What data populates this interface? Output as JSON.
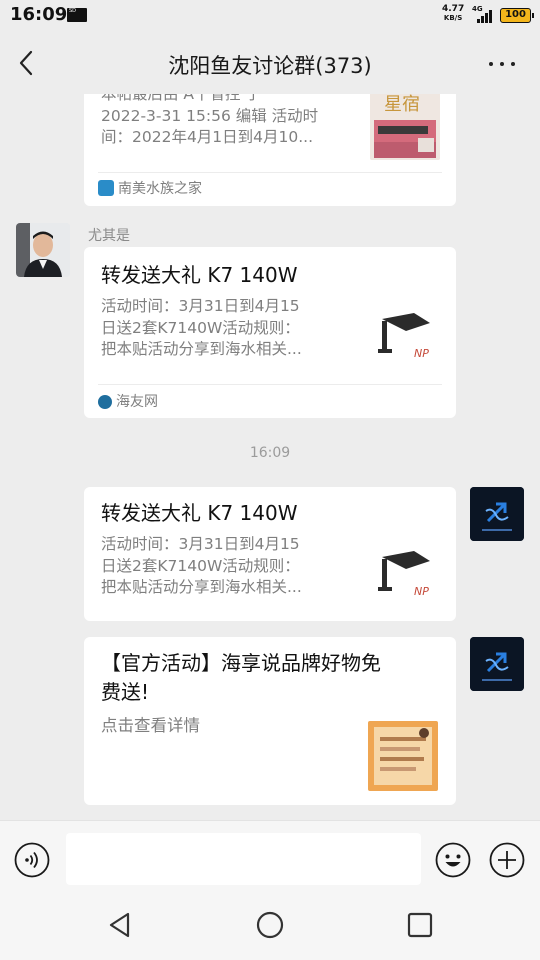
{
  "status_bar": {
    "time": "16:09",
    "sd_label": "SD",
    "speed_value": "4.77",
    "speed_unit": "KB/S",
    "network": "4G",
    "battery": "100"
  },
  "header": {
    "title": "沈阳鱼友讨论群(373)",
    "back_icon": "chevron-left-icon",
    "more_icon": "more-dots-icon"
  },
  "messages": [
    {
      "type": "link-card-partial",
      "desc_lines": [
        "本帖最后由 A十省控 于",
        "2022-3-31 15:56 编辑 活动时",
        "间：2022年4月1日到4月10..."
      ],
      "thumb_label": "星宿",
      "source": "南美水族之家"
    },
    {
      "type": "link-card",
      "sender": "尤其是",
      "title": "转发送大礼 K7 140W",
      "desc_lines": [
        "活动时间：3月31日到4月15",
        "日送2套K7140W活动规则：",
        "把本贴活动分享到海水相关..."
      ],
      "source": "海友网"
    },
    {
      "type": "timestamp",
      "text": "16:09"
    },
    {
      "type": "link-card-self",
      "title": "转发送大礼 K7 140W",
      "desc_lines": [
        "活动时间：3月31日到4月15",
        "日送2套K7140W活动规则：",
        "把本贴活动分享到海水相关..."
      ]
    },
    {
      "type": "link-card-self",
      "title_lines": [
        "【官方活动】海享说品牌好物免",
        "费送!"
      ],
      "desc": "点击查看详情"
    }
  ],
  "input_bar": {
    "voice_icon": "voice-icon",
    "emoji_icon": "emoji-icon",
    "plus_icon": "plus-icon"
  },
  "system_nav": {
    "back_icon": "triangle-back-icon",
    "home_icon": "circle-home-icon",
    "recents_icon": "square-recents-icon"
  },
  "colors": {
    "background": "#ededed",
    "card": "#ffffff",
    "battery": "#f3b51b",
    "self_avatar": "#0b1a2e"
  }
}
